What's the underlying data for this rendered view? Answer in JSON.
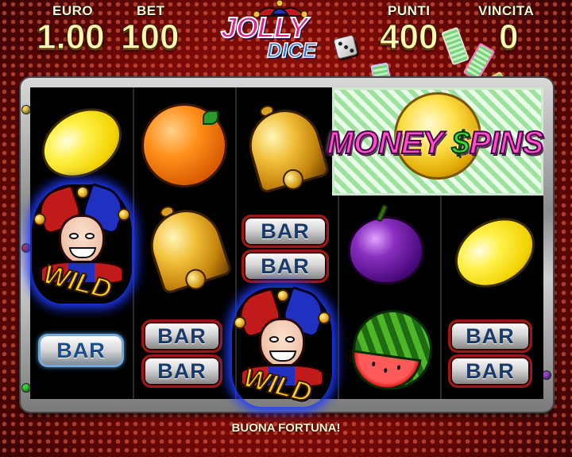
{
  "header": {
    "euro_label": "EURO",
    "euro_value": "1.00",
    "bet_label": "BET",
    "bet_value": "100",
    "points_label": "PUNTI",
    "points_value": "400",
    "win_label": "VINCITA",
    "win_value": "0"
  },
  "logo": {
    "line1": "JOLLY",
    "line2": "DICE"
  },
  "feature": {
    "title_part1": "MONE",
    "title_currency": "Y",
    "title_dollar": "$",
    "title_part2": "PINS"
  },
  "reels": {
    "columns": 5,
    "symbols": [
      [
        "lemon",
        "joker-wild",
        "bar"
      ],
      [
        "orange",
        "bell",
        "double-bar"
      ],
      [
        "bell",
        "double-bar",
        "joker-wild"
      ],
      [
        "money-spins",
        "plum",
        "watermelon"
      ],
      [
        "money-spins",
        "lemon",
        "double-bar"
      ]
    ],
    "bar_label": "BAR",
    "wild_label": "WILD"
  },
  "colors": {
    "background": "#8a0e08",
    "value_text": "#fff7b0",
    "frame": "#b5b5b5",
    "bar_text": "#1a3a6a",
    "wild_text": "#ffd21a",
    "money_spins_text": "#ff4fc6"
  },
  "status": {
    "message": "BUONA FORTUNA!"
  }
}
